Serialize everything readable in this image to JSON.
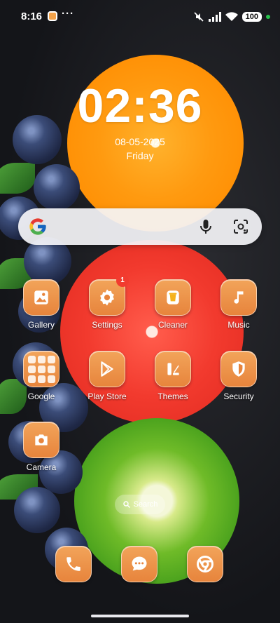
{
  "status_bar": {
    "time": "8:16",
    "more": "···",
    "battery": "100",
    "icons": [
      "notification-app-icon",
      "mute-icon",
      "signal-icon",
      "wifi-icon",
      "battery-icon",
      "privacy-dot-icon"
    ]
  },
  "clock": {
    "time": "02:36",
    "date": "08-05-2025",
    "day": "Friday"
  },
  "search_widget": {
    "icons": [
      "google-logo-icon",
      "microphone-icon",
      "google-lens-icon"
    ]
  },
  "apps": [
    {
      "label": "Gallery",
      "icon": "gallery-icon"
    },
    {
      "label": "Settings",
      "icon": "gear-icon",
      "badge": "1"
    },
    {
      "label": "Cleaner",
      "icon": "trash-icon"
    },
    {
      "label": "Music",
      "icon": "music-note-icon"
    },
    {
      "label": "Google",
      "icon": "folder-icon"
    },
    {
      "label": "Play Store",
      "icon": "play-store-icon"
    },
    {
      "label": "Themes",
      "icon": "themes-icon"
    },
    {
      "label": "Security",
      "icon": "shield-icon"
    },
    {
      "label": "Camera",
      "icon": "camera-icon"
    }
  ],
  "home_search_pill": {
    "label": "Search",
    "icon": "search-icon"
  },
  "dock": [
    {
      "name": "phone",
      "icon": "phone-icon"
    },
    {
      "name": "messages",
      "icon": "message-icon"
    },
    {
      "name": "chrome",
      "icon": "chrome-icon"
    }
  ],
  "colors": {
    "icon_gradient_top": "#f2a45a",
    "icon_gradient_bottom": "#e7843c",
    "badge": "#f23b2f",
    "background": "#17181c"
  }
}
